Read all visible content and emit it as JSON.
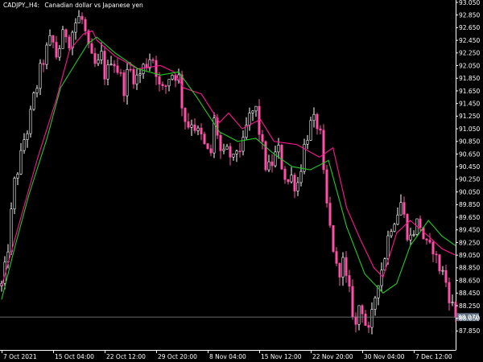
{
  "header": {
    "symbol_label": "CADJPY,,H4:",
    "description": "Canadian dollar vs Japanese yen"
  },
  "current_price": "88.070",
  "colors": {
    "background": "#000000",
    "axis": "#ffffff",
    "bull_candle": "#ffffff",
    "bear_candle": "#ff4fa8",
    "fast_line": "#ff1493",
    "slow_line": "#22cc22",
    "price_line": "#8a8a8a",
    "price_label_bg": "#5e6e82"
  },
  "chart_data": {
    "type": "candlestick",
    "ylim": [
      87.55,
      93.05
    ],
    "y_ticks": [
      "93.050",
      "92.850",
      "92.650",
      "92.450",
      "92.250",
      "92.050",
      "91.850",
      "91.650",
      "91.450",
      "91.250",
      "91.050",
      "90.850",
      "90.650",
      "90.450",
      "90.250",
      "90.050",
      "89.850",
      "89.650",
      "89.450",
      "89.250",
      "89.050",
      "88.850",
      "88.650",
      "88.450",
      "88.250",
      "88.050",
      "87.850"
    ],
    "x_ticks": [
      "7 Oct 2021",
      "15 Oct 04:00",
      "22 Oct 12:00",
      "29 Oct 20:00",
      "8 Nov 04:00",
      "15 Nov 12:00",
      "22 Nov 20:00",
      "30 Nov 04:00",
      "7 Dec 12:00"
    ],
    "current_price": 88.07,
    "series": [
      {
        "type": "line",
        "role": "fast-moving-average",
        "values": [
          [
            0.0,
            88.56
          ],
          [
            0.08,
            90.6
          ],
          [
            0.12,
            91.5
          ],
          [
            0.15,
            92.3
          ],
          [
            0.18,
            92.55
          ],
          [
            0.2,
            92.6
          ],
          [
            0.21,
            92.45
          ],
          [
            0.25,
            92.2
          ],
          [
            0.3,
            92.0
          ],
          [
            0.35,
            92.05
          ],
          [
            0.38,
            91.95
          ],
          [
            0.4,
            91.7
          ],
          [
            0.44,
            91.6
          ],
          [
            0.48,
            91.15
          ],
          [
            0.5,
            91.3
          ],
          [
            0.53,
            91.05
          ],
          [
            0.57,
            91.2
          ],
          [
            0.6,
            90.85
          ],
          [
            0.65,
            90.8
          ],
          [
            0.7,
            90.6
          ],
          [
            0.73,
            90.75
          ],
          [
            0.76,
            89.8
          ],
          [
            0.79,
            89.3
          ],
          [
            0.82,
            88.85
          ],
          [
            0.84,
            88.7
          ],
          [
            0.87,
            89.4
          ],
          [
            0.9,
            89.6
          ],
          [
            0.94,
            89.35
          ],
          [
            0.97,
            89.15
          ],
          [
            1.0,
            89.05
          ]
        ]
      },
      {
        "type": "line",
        "role": "slow-moving-average",
        "values": [
          [
            0.0,
            88.35
          ],
          [
            0.03,
            89.2
          ],
          [
            0.06,
            90.0
          ],
          [
            0.1,
            90.9
          ],
          [
            0.13,
            91.7
          ],
          [
            0.16,
            92.05
          ],
          [
            0.19,
            92.4
          ],
          [
            0.21,
            92.5
          ],
          [
            0.25,
            92.25
          ],
          [
            0.3,
            92.0
          ],
          [
            0.35,
            91.9
          ],
          [
            0.39,
            91.95
          ],
          [
            0.43,
            91.55
          ],
          [
            0.48,
            91.0
          ],
          [
            0.52,
            90.85
          ],
          [
            0.56,
            90.9
          ],
          [
            0.6,
            90.65
          ],
          [
            0.64,
            90.45
          ],
          [
            0.68,
            90.4
          ],
          [
            0.72,
            90.55
          ],
          [
            0.76,
            89.5
          ],
          [
            0.8,
            88.75
          ],
          [
            0.84,
            88.45
          ],
          [
            0.87,
            88.6
          ],
          [
            0.9,
            89.2
          ],
          [
            0.94,
            89.6
          ],
          [
            0.97,
            89.35
          ],
          [
            1.0,
            89.2
          ]
        ]
      },
      {
        "type": "candlestick",
        "path": [
          [
            0.0,
            88.56
          ],
          [
            0.01,
            88.9
          ],
          [
            0.02,
            89.6
          ],
          [
            0.03,
            90.3
          ],
          [
            0.04,
            90.5
          ],
          [
            0.05,
            90.9
          ],
          [
            0.06,
            91.1
          ],
          [
            0.07,
            91.5
          ],
          [
            0.08,
            91.8
          ],
          [
            0.09,
            92.1
          ],
          [
            0.1,
            92.3
          ],
          [
            0.11,
            92.5
          ],
          [
            0.12,
            92.2
          ],
          [
            0.13,
            92.4
          ],
          [
            0.14,
            92.6
          ],
          [
            0.15,
            92.45
          ],
          [
            0.16,
            92.7
          ],
          [
            0.17,
            92.8
          ],
          [
            0.18,
            92.75
          ],
          [
            0.19,
            92.3
          ],
          [
            0.2,
            92.1
          ],
          [
            0.21,
            92.0
          ],
          [
            0.22,
            92.2
          ],
          [
            0.23,
            91.8
          ],
          [
            0.24,
            92.2
          ],
          [
            0.25,
            92.1
          ],
          [
            0.26,
            91.9
          ],
          [
            0.27,
            91.7
          ],
          [
            0.28,
            92.0
          ],
          [
            0.29,
            91.9
          ],
          [
            0.3,
            91.85
          ],
          [
            0.31,
            92.0
          ],
          [
            0.32,
            92.1
          ],
          [
            0.33,
            92.25
          ],
          [
            0.34,
            92.0
          ],
          [
            0.35,
            91.6
          ],
          [
            0.36,
            91.7
          ],
          [
            0.37,
            91.9
          ],
          [
            0.38,
            91.95
          ],
          [
            0.39,
            91.85
          ],
          [
            0.4,
            91.3
          ],
          [
            0.41,
            91.1
          ],
          [
            0.42,
            91.2
          ],
          [
            0.43,
            91.0
          ],
          [
            0.44,
            90.9
          ],
          [
            0.45,
            90.7
          ],
          [
            0.46,
            90.6
          ],
          [
            0.47,
            91.3
          ],
          [
            0.48,
            90.7
          ],
          [
            0.49,
            90.6
          ],
          [
            0.5,
            90.7
          ],
          [
            0.51,
            90.5
          ],
          [
            0.52,
            90.8
          ],
          [
            0.53,
            90.7
          ],
          [
            0.54,
            91.1
          ],
          [
            0.55,
            91.3
          ],
          [
            0.56,
            91.35
          ],
          [
            0.57,
            90.9
          ],
          [
            0.58,
            90.5
          ],
          [
            0.59,
            90.4
          ],
          [
            0.6,
            90.6
          ],
          [
            0.61,
            90.7
          ],
          [
            0.62,
            90.4
          ],
          [
            0.63,
            90.2
          ],
          [
            0.64,
            90.3
          ],
          [
            0.65,
            90.1
          ],
          [
            0.66,
            90.5
          ],
          [
            0.67,
            90.9
          ],
          [
            0.68,
            91.1
          ],
          [
            0.69,
            91.15
          ],
          [
            0.7,
            91.1
          ],
          [
            0.71,
            90.2
          ],
          [
            0.72,
            89.6
          ],
          [
            0.73,
            89.2
          ],
          [
            0.74,
            88.7
          ],
          [
            0.75,
            89.0
          ],
          [
            0.76,
            88.6
          ],
          [
            0.77,
            88.3
          ],
          [
            0.78,
            87.9
          ],
          [
            0.79,
            88.4
          ],
          [
            0.8,
            88.0
          ],
          [
            0.81,
            87.75
          ],
          [
            0.82,
            88.3
          ],
          [
            0.83,
            88.7
          ],
          [
            0.84,
            88.9
          ],
          [
            0.85,
            89.3
          ],
          [
            0.86,
            89.6
          ],
          [
            0.87,
            89.7
          ],
          [
            0.88,
            89.9
          ],
          [
            0.89,
            89.5
          ],
          [
            0.9,
            89.3
          ],
          [
            0.91,
            89.5
          ],
          [
            0.92,
            89.6
          ],
          [
            0.93,
            89.3
          ],
          [
            0.94,
            89.1
          ],
          [
            0.95,
            89.2
          ],
          [
            0.96,
            88.9
          ],
          [
            0.97,
            88.8
          ],
          [
            0.98,
            88.6
          ],
          [
            0.99,
            88.3
          ],
          [
            1.0,
            88.07
          ]
        ]
      }
    ]
  }
}
